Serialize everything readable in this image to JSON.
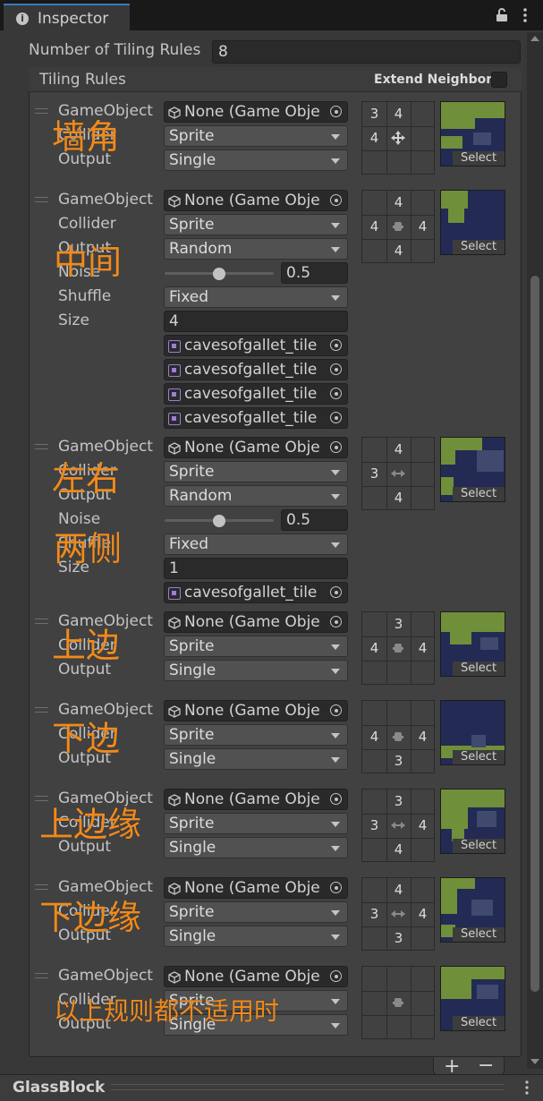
{
  "window": {
    "tab_title": "Inspector",
    "tab_icon": "info-icon"
  },
  "tiling": {
    "count_label": "Number of Tiling Rules",
    "count_value": "8",
    "section_title": "Tiling Rules",
    "extend_label": "Extend Neighbor",
    "extend_checked": false
  },
  "labels": {
    "gameobject": "GameObject",
    "collider": "Collider",
    "output": "Output",
    "noise": "Noise",
    "shuffle": "Shuffle",
    "size": "Size",
    "select": "Select"
  },
  "rules": [
    {
      "gameobject": "None (Game Obje",
      "collider": "Sprite",
      "output": "Single",
      "grid": [
        "3",
        "4",
        "",
        "4",
        "",
        "",
        "",
        "",
        ""
      ],
      "center": "cross-move",
      "annotation": "墙角"
    },
    {
      "gameobject": "None (Game Obje",
      "collider": "Sprite",
      "output": "Random",
      "noise": "0.5",
      "noise_fraction": 0.5,
      "shuffle": "Fixed",
      "size": "4",
      "sprites": [
        "cavesofgallet_tile",
        "cavesofgallet_tile",
        "cavesofgallet_tile",
        "cavesofgallet_tile"
      ],
      "grid": [
        "",
        "4",
        "",
        "4",
        "",
        "4",
        "",
        "4",
        ""
      ],
      "center": "dot",
      "annotation": "中间"
    },
    {
      "gameobject": "None (Game Obje",
      "collider": "Sprite",
      "output": "Random",
      "noise": "0.5",
      "noise_fraction": 0.5,
      "shuffle": "Fixed",
      "size": "1",
      "sprites": [
        "cavesofgallet_tile"
      ],
      "grid": [
        "",
        "4",
        "",
        "3",
        "",
        "",
        "",
        "4",
        ""
      ],
      "center": "horizontal",
      "annotation": "左右\n两侧"
    },
    {
      "gameobject": "None (Game Obje",
      "collider": "Sprite",
      "output": "Single",
      "grid": [
        "",
        "3",
        "",
        "4",
        "",
        "4",
        "",
        "",
        ""
      ],
      "center": "dot",
      "annotation": "上边"
    },
    {
      "gameobject": "None (Game Obje",
      "collider": "Sprite",
      "output": "Single",
      "grid": [
        "",
        "",
        "",
        "4",
        "",
        "4",
        "",
        "3",
        ""
      ],
      "center": "dot",
      "annotation": "下边"
    },
    {
      "gameobject": "None (Game Obje",
      "collider": "Sprite",
      "output": "Single",
      "grid": [
        "",
        "3",
        "",
        "3",
        "",
        "4",
        "",
        "4",
        ""
      ],
      "center": "horizontal",
      "annotation": "上边缘"
    },
    {
      "gameobject": "None (Game Obje",
      "collider": "Sprite",
      "output": "Single",
      "grid": [
        "",
        "4",
        "",
        "3",
        "",
        "4",
        "",
        "3",
        ""
      ],
      "center": "horizontal",
      "annotation": "下边缘"
    },
    {
      "gameobject": "None (Game Obje",
      "collider": "Sprite",
      "output": "Single",
      "grid": [
        "",
        "",
        "",
        "",
        "",
        "",
        "",
        "",
        ""
      ],
      "center": "dot",
      "annotation": "以上规则都不适用时"
    }
  ],
  "footer": {
    "add": "+",
    "remove": "−"
  },
  "bottom": {
    "title": "GlassBlock"
  },
  "colors": {
    "annotation": "#f08a1c",
    "preview_bg": "#232a54",
    "preview_green": "#6f8f3a",
    "preview_dark": "#3f4a6e"
  }
}
